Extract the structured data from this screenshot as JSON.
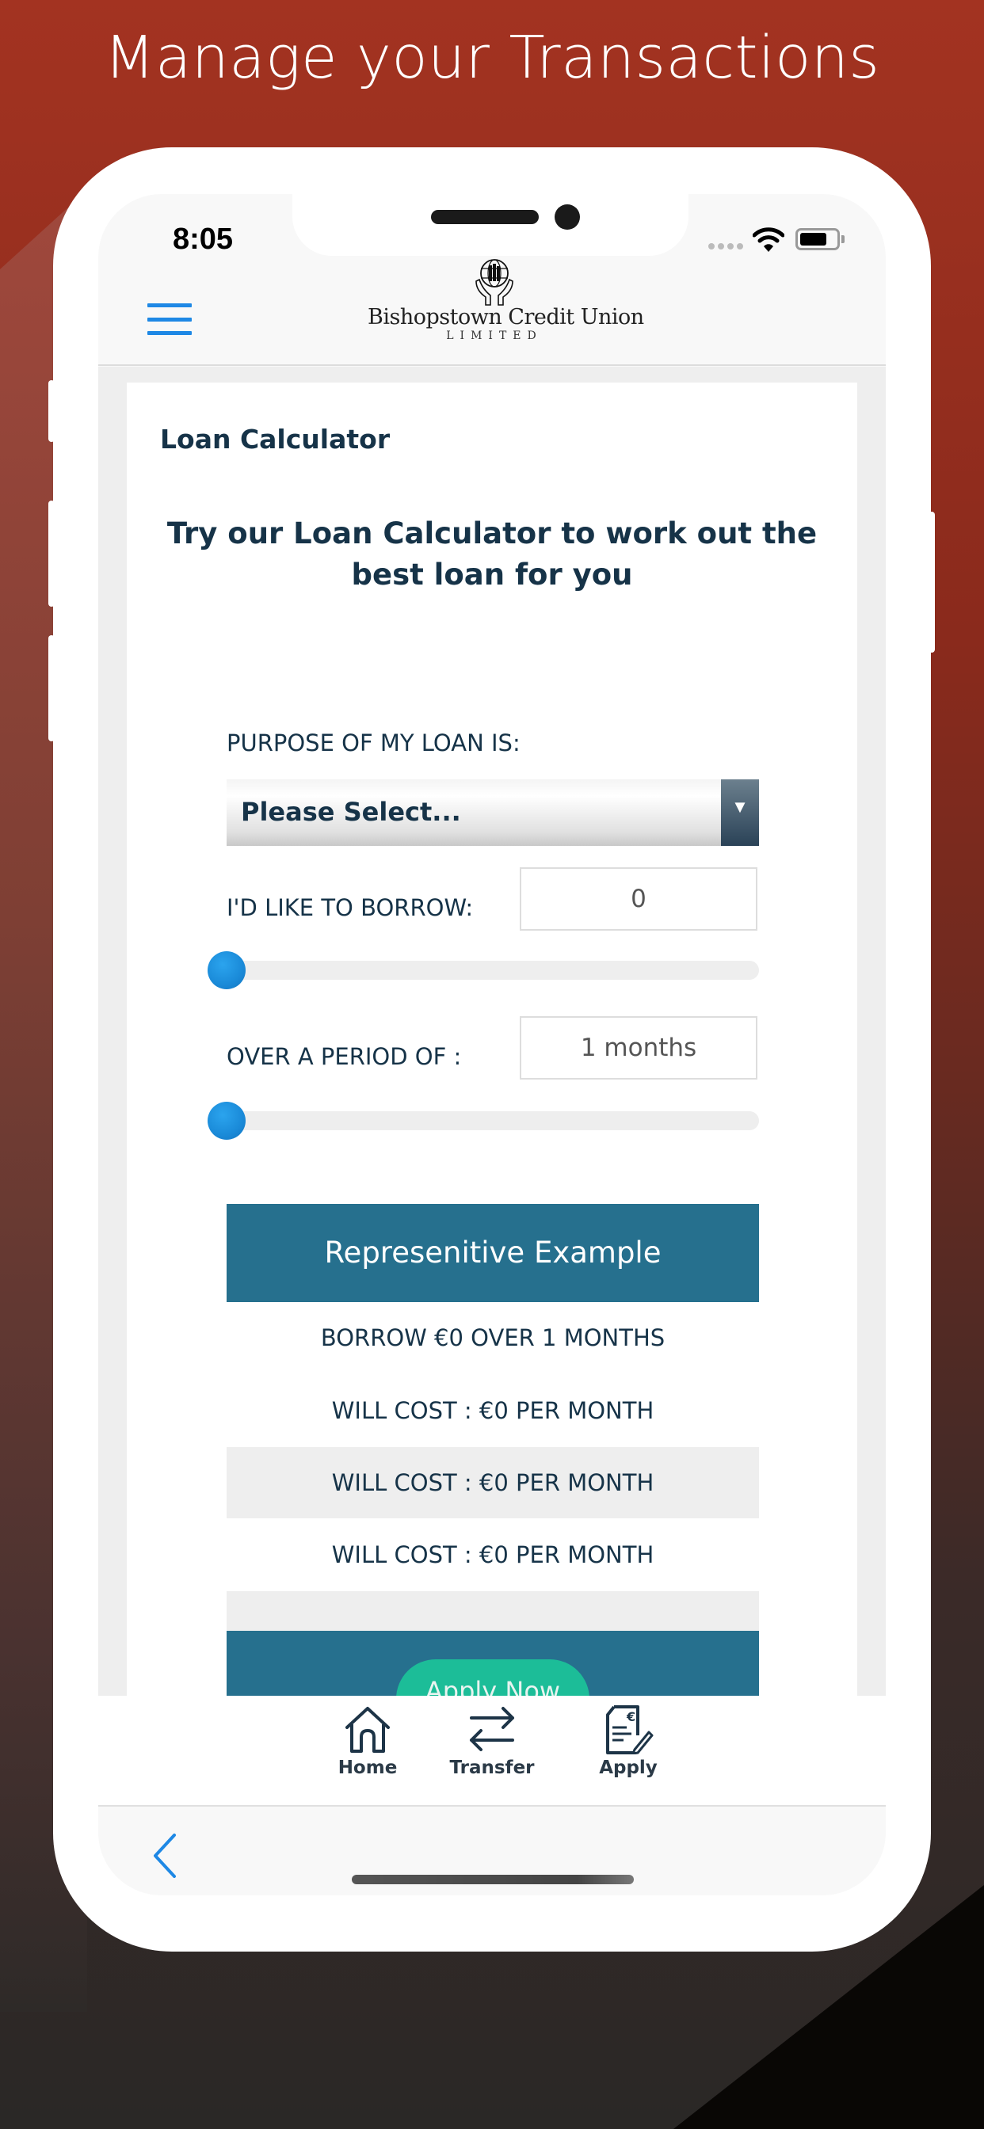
{
  "promo": {
    "headline": "Manage your Transactions"
  },
  "status_bar": {
    "time": "8:05",
    "icons": [
      "signal-dots-icon",
      "wifi-icon",
      "battery-icon"
    ]
  },
  "header": {
    "menu_icon": "hamburger-menu-icon",
    "logo_name": "Bishopstown Credit Union",
    "logo_subtitle": "LIMITED"
  },
  "page": {
    "title": "Loan Calculator",
    "tagline": "Try our Loan Calculator to work out the best loan for you"
  },
  "form": {
    "purpose_label": "PURPOSE OF MY LOAN IS:",
    "purpose_select": {
      "selected": "Please Select..."
    },
    "borrow_label": "I'D LIKE TO BORROW:",
    "borrow_value": "0",
    "borrow_slider_fraction": 0,
    "period_label": "OVER A PERIOD OF :",
    "period_value": "1 months",
    "period_slider_fraction": 0
  },
  "representative_example": {
    "heading": "Represenitive Example",
    "summary": "BORROW €0 OVER 1 MONTHS",
    "rows": [
      "WILL COST : €0 PER MONTH",
      "WILL COST : €0 PER MONTH",
      "WILL COST : €0 PER MONTH"
    ],
    "apply_button": "Apply Now"
  },
  "tabbar": {
    "items": [
      {
        "label": "Home",
        "icon": "home-icon"
      },
      {
        "label": "Transfer",
        "icon": "transfer-icon"
      },
      {
        "label": "Apply",
        "icon": "apply-document-icon"
      }
    ]
  },
  "colors": {
    "accent_blue": "#1e88e5",
    "navy_text": "#163348",
    "teal_band": "#26708e",
    "apply_green": "#1cbd98",
    "slider_thumb": "#1a8ad8"
  }
}
